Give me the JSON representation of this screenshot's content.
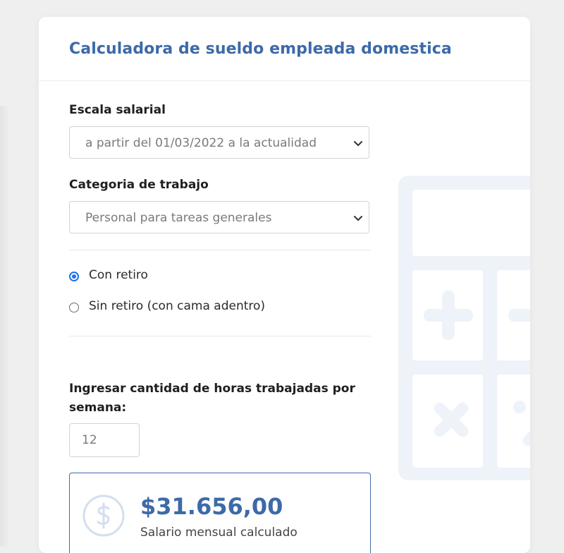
{
  "header": {
    "title": "Calculadora de sueldo empleada domestica"
  },
  "form": {
    "escala": {
      "label": "Escala salarial",
      "selected": "a partir del 01/03/2022 a la actualidad"
    },
    "categoria": {
      "label": "Categoria de trabajo",
      "selected": "Personal para tareas generales"
    },
    "modalidad": {
      "options": [
        {
          "label": "Con retiro",
          "checked": true
        },
        {
          "label": "Sin retiro (con cama adentro)",
          "checked": false
        }
      ]
    },
    "horas": {
      "label": "Ingresar cantidad de horas trabajadas por semana:",
      "value": "12"
    }
  },
  "result": {
    "amount": "$31.656,00",
    "caption": "Salario mensual calculado",
    "icon": "dollar-circle-icon"
  },
  "colors": {
    "accent": "#3d6aa8",
    "radio": "#1a73e8",
    "illustration": "#eef3f9"
  }
}
